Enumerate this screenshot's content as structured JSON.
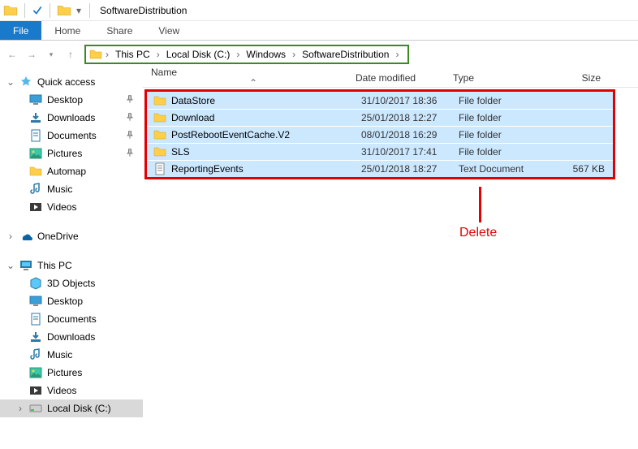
{
  "window": {
    "title": "SoftwareDistribution"
  },
  "ribbon": {
    "file": "File",
    "tabs": [
      "Home",
      "Share",
      "View"
    ]
  },
  "breadcrumb": [
    "This PC",
    "Local Disk (C:)",
    "Windows",
    "SoftwareDistribution"
  ],
  "columns": {
    "name": "Name",
    "date": "Date modified",
    "type": "Type",
    "size": "Size"
  },
  "files": [
    {
      "name": "DataStore",
      "date": "31/10/2017 18:36",
      "type": "File folder",
      "size": "",
      "icon": "folder"
    },
    {
      "name": "Download",
      "date": "25/01/2018 12:27",
      "type": "File folder",
      "size": "",
      "icon": "folder"
    },
    {
      "name": "PostRebootEventCache.V2",
      "date": "08/01/2018 16:29",
      "type": "File folder",
      "size": "",
      "icon": "folder"
    },
    {
      "name": "SLS",
      "date": "31/10/2017 17:41",
      "type": "File folder",
      "size": "",
      "icon": "folder"
    },
    {
      "name": "ReportingEvents",
      "date": "25/01/2018 18:27",
      "type": "Text Document",
      "size": "567 KB",
      "icon": "text"
    }
  ],
  "sidebar": {
    "quick": {
      "label": "Quick access",
      "items": [
        {
          "label": "Desktop",
          "icon": "desktop",
          "pinned": true
        },
        {
          "label": "Downloads",
          "icon": "downloads",
          "pinned": true
        },
        {
          "label": "Documents",
          "icon": "documents",
          "pinned": true
        },
        {
          "label": "Pictures",
          "icon": "pictures",
          "pinned": true
        },
        {
          "label": "Automap",
          "icon": "folder",
          "pinned": false
        },
        {
          "label": "Music",
          "icon": "music",
          "pinned": false
        },
        {
          "label": "Videos",
          "icon": "videos",
          "pinned": false
        }
      ]
    },
    "onedrive": {
      "label": "OneDrive"
    },
    "thispc": {
      "label": "This PC",
      "items": [
        {
          "label": "3D Objects",
          "icon": "3d"
        },
        {
          "label": "Desktop",
          "icon": "desktop"
        },
        {
          "label": "Documents",
          "icon": "documents"
        },
        {
          "label": "Downloads",
          "icon": "downloads"
        },
        {
          "label": "Music",
          "icon": "music"
        },
        {
          "label": "Pictures",
          "icon": "pictures"
        },
        {
          "label": "Videos",
          "icon": "videos"
        },
        {
          "label": "Local Disk (C:)",
          "icon": "disk",
          "selected": true
        }
      ]
    }
  },
  "annotation": "Delete"
}
